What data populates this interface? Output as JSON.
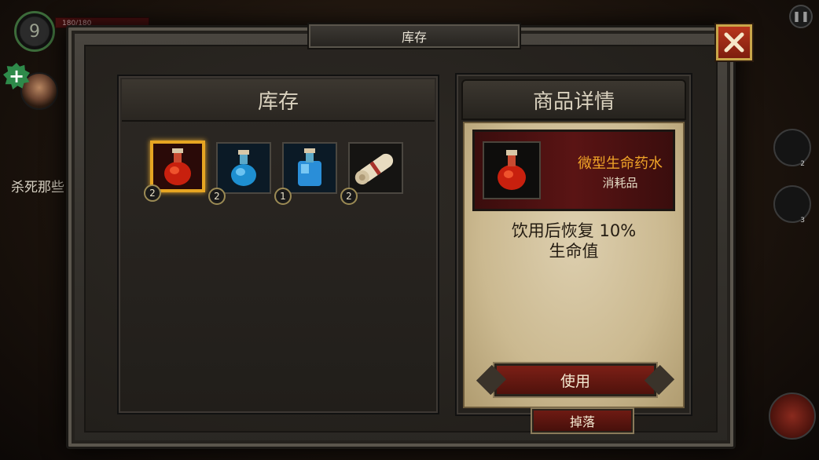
{
  "hud": {
    "level": "9",
    "hp_text": "180/180",
    "quest_text": "杀死那些",
    "slot_counts": [
      "2",
      "3"
    ]
  },
  "modal": {
    "title": "库存",
    "close_label": "✕"
  },
  "inventory": {
    "header": "库存",
    "items": [
      {
        "name": "red-potion",
        "count": "2",
        "selected": true
      },
      {
        "name": "blue-potion",
        "count": "2",
        "selected": false
      },
      {
        "name": "blue-flask",
        "count": "1",
        "selected": false
      },
      {
        "name": "scroll",
        "count": "2",
        "selected": false
      }
    ]
  },
  "details": {
    "header": "商品详情",
    "item_name": "微型生命药水",
    "item_type": "消耗品",
    "desc_line1": "饮用后恢复 10%",
    "desc_line2": "生命值",
    "use_label": "使用",
    "drop_label": "掉落"
  },
  "colors": {
    "selected_border": "#e6a522",
    "item_name": "#f0a428",
    "close_button": "#b8361d"
  }
}
